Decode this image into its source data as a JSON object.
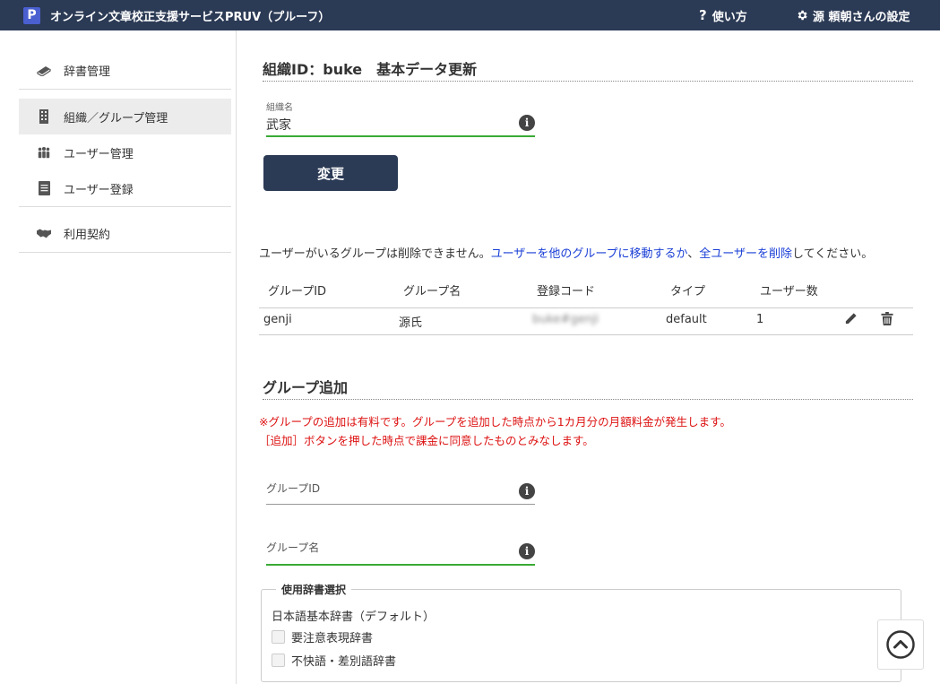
{
  "header": {
    "logo_letter": "P",
    "title": "オンライン文章校正支援サービスPRUV（プルーフ）",
    "help_label": "使い方",
    "settings_label": "源 頼朝さんの設定"
  },
  "sidebar": {
    "items": [
      {
        "label": "辞書管理",
        "icon": "book-icon"
      },
      {
        "label": "組織／グループ管理",
        "icon": "building-icon"
      },
      {
        "label": "ユーザー管理",
        "icon": "users-icon"
      },
      {
        "label": "ユーザー登録",
        "icon": "clipboard-icon"
      },
      {
        "label": "利用契約",
        "icon": "handshake-icon"
      }
    ],
    "active_index": 1
  },
  "org": {
    "section_title": "組織ID：buke　基本データ更新",
    "name_label": "組織名",
    "name_value": "武家",
    "change_button": "変更"
  },
  "notice": {
    "prefix": "ユーザーがいるグループは削除できません。",
    "link_move": "ユーザーを他のグループに移動するか",
    "middle": "、",
    "link_delete": "全ユーザーを削除",
    "suffix": "してください。"
  },
  "groups_table": {
    "headers": [
      "グループID",
      "グループ名",
      "登録コード",
      "タイプ",
      "ユーザー数"
    ],
    "rows": [
      {
        "group_id": "genji",
        "group_name": "源氏",
        "reg_code": "buke#genji",
        "type": "default",
        "users": "1"
      }
    ]
  },
  "group_add": {
    "section_title": "グループ追加",
    "warning_line1": "※グループの追加は有料です。グループを追加した時点から1カ月分の月額料金が発生します。",
    "warning_line2": "［追加］ボタンを押した時点で課金に同意したものとみなします。",
    "id_placeholder": "グループID",
    "name_placeholder": "グループ名",
    "dict_legend": "使用辞書選択",
    "dict_default": "日本語基本辞書（デフォルト）",
    "dict_options": [
      "要注意表現辞書",
      "不快語・差別語辞書"
    ]
  },
  "colors": {
    "header_bg": "#2b3a55",
    "accent_green": "#3aaa35",
    "link_blue": "#1a3fd6",
    "warning_red": "#dd1111"
  }
}
